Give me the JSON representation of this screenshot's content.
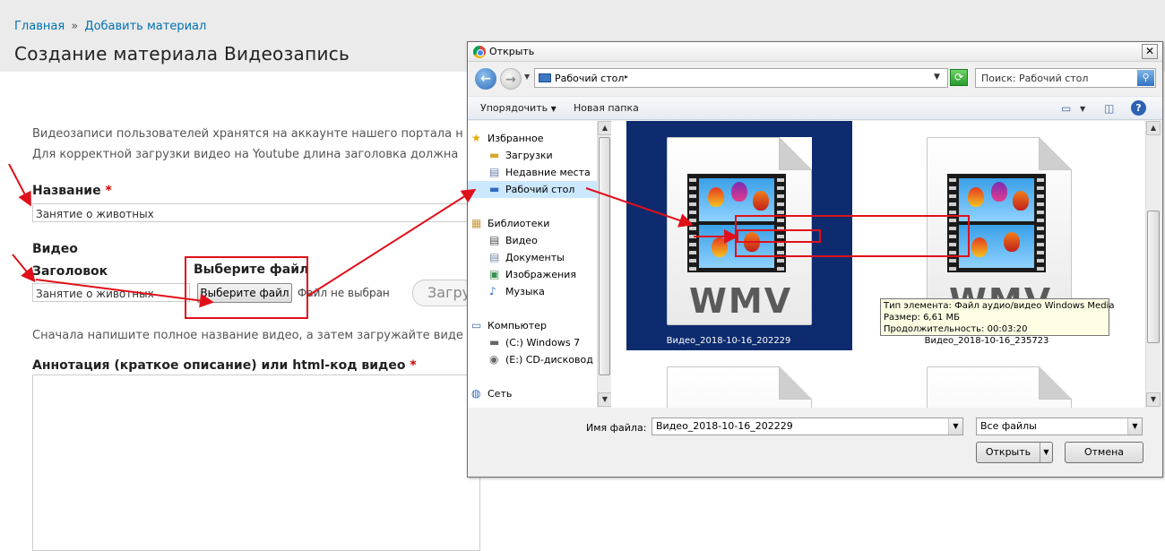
{
  "breadcrumb": {
    "home": "Главная",
    "separator": "»",
    "add": "Добавить материал"
  },
  "page_title": "Создание материала Видеозапись",
  "intro": {
    "line1": "Видеозаписи пользователей хранятся на аккаунте нашего портала н",
    "line2": "Для корректной загрузки видео на Youtube длина заголовка должна"
  },
  "form": {
    "name_label": "Название",
    "required_mark": "*",
    "name_value": "Занятие о животных",
    "video_label": "Видео",
    "heading_label": "Заголовок",
    "heading_value": "Занятие о животных",
    "choose_file_caption": "Выберите файл",
    "choose_file_button": "Выберите файл",
    "no_file": "Файл не выбран",
    "upload_button": "Загруз",
    "hint": "Сначала напишите полное название видео, а затем загружайте виде",
    "annotation_label": "Аннотация (краткое описание) или html-код видео"
  },
  "dialog": {
    "title": "Открыть",
    "close": "✕",
    "address": "Рабочий стол",
    "address_arrow": "▸",
    "search_placeholder": "Поиск: Рабочий стол",
    "toolbar": {
      "organize": "Упорядочить",
      "new_folder": "Новая папка"
    },
    "nav": {
      "favorites": "Избранное",
      "downloads": "Загрузки",
      "recent": "Недавние места",
      "desktop": "Рабочий стол",
      "libraries": "Библиотеки",
      "video": "Видео",
      "documents": "Документы",
      "images": "Изображения",
      "music": "Музыка",
      "computer": "Компьютер",
      "drive_c": "(C:) Windows 7",
      "drive_e": "(E:) CD-дисковод",
      "network": "Сеть"
    },
    "files": [
      {
        "name": "Видео_2018-10-16_202229",
        "type_label": "WMV"
      },
      {
        "name": "Видео_2018-10-16_235723",
        "type_label": "WMV"
      }
    ],
    "tooltip": {
      "type": "Тип элемента: Файл аудио/видео Windows Media",
      "size": "Размер: 6,61 МБ",
      "duration": "Продолжительность: 00:03:20"
    },
    "filename_label": "Имя файла:",
    "filename_value": "Видео_2018-10-16_202229",
    "filter_value": "Все файлы",
    "open_button": "Открыть",
    "cancel_button": "Отмена"
  },
  "colors": {
    "link": "#0071b3",
    "highlight_red": "#e0101a",
    "selection_blue": "#0d2b6e"
  }
}
